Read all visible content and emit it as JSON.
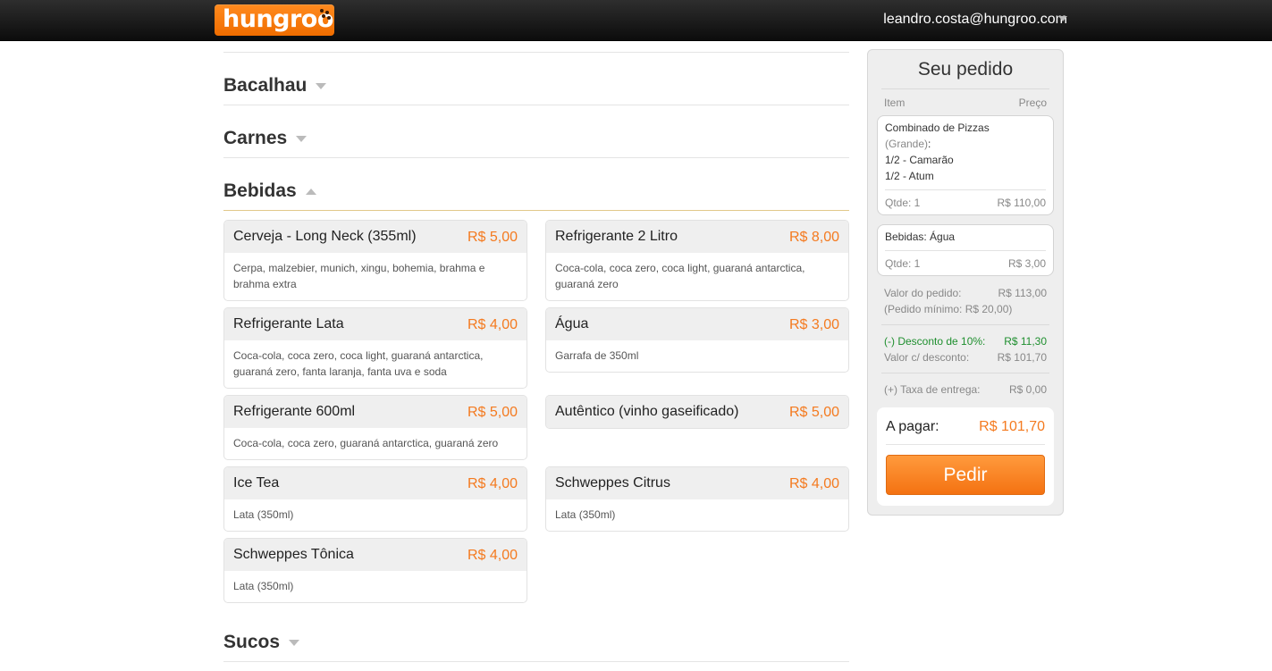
{
  "header": {
    "logo_text": "hungroo",
    "user_email": "leandro.costa@hungroo.com",
    "brand_color": "#f47a1f"
  },
  "menu": {
    "categories": [
      {
        "name": "Bacalhau",
        "expanded": false
      },
      {
        "name": "Carnes",
        "expanded": false
      },
      {
        "name": "Bebidas",
        "expanded": true
      },
      {
        "name": "Sucos",
        "expanded": false
      }
    ],
    "bebidas": [
      {
        "name": "Cerveja - Long Neck (355ml)",
        "price": "R$ 5,00",
        "desc": "Cerpa, malzebier, munich, xingu, bohemia, brahma e brahma extra"
      },
      {
        "name": "Refrigerante 2 Litro",
        "price": "R$ 8,00",
        "desc": "Coca-cola, coca zero, coca light, guaraná antarctica, guaraná zero"
      },
      {
        "name": "Refrigerante Lata",
        "price": "R$ 4,00",
        "desc": "Coca-cola, coca zero, coca light, guaraná antarctica, guaraná zero, fanta laranja, fanta uva e soda"
      },
      {
        "name": "Água",
        "price": "R$ 3,00",
        "desc": "Garrafa de 350ml"
      },
      {
        "name": "Refrigerante 600ml",
        "price": "R$ 5,00",
        "desc": "Coca-cola, coca zero, guaraná antarctica, guaraná zero"
      },
      {
        "name": "Autêntico (vinho gaseificado)",
        "price": "R$ 5,00",
        "desc": ""
      },
      {
        "name": "Ice Tea",
        "price": "R$ 4,00",
        "desc": "Lata (350ml)"
      },
      {
        "name": "Schweppes Citrus",
        "price": "R$ 4,00",
        "desc": "Lata (350ml)"
      },
      {
        "name": "Schweppes Tônica",
        "price": "R$ 4,00",
        "desc": "Lata (350ml)"
      }
    ]
  },
  "order": {
    "title": "Seu pedido",
    "col_item": "Item",
    "col_price": "Preço",
    "items": [
      {
        "line1": "Combinado de Pizzas",
        "line2": "(Grande)",
        "line2_suffix": ":",
        "line3": "1/2 - Camarão",
        "line4": "1/2 - Atum",
        "qty": "Qtde: 1",
        "price": "R$ 110,00"
      },
      {
        "line1": "Bebidas: Água",
        "qty": "Qtde: 1",
        "price": "R$ 3,00"
      }
    ],
    "valor_label": "Valor do pedido:",
    "valor_value": "R$ 113,00",
    "minimo": "(Pedido mínimo: R$ 20,00)",
    "desconto_label": "(-) Desconto de 10%:",
    "desconto_value": "R$ 11,30",
    "valor_desc_label": "Valor c/ desconto:",
    "valor_desc_value": "R$ 101,70",
    "taxa_label": "(+) Taxa de entrega:",
    "taxa_value": "R$ 0,00",
    "pagar_label": "A pagar:",
    "pagar_value": "R$ 101,70",
    "button_label": "Pedir"
  }
}
